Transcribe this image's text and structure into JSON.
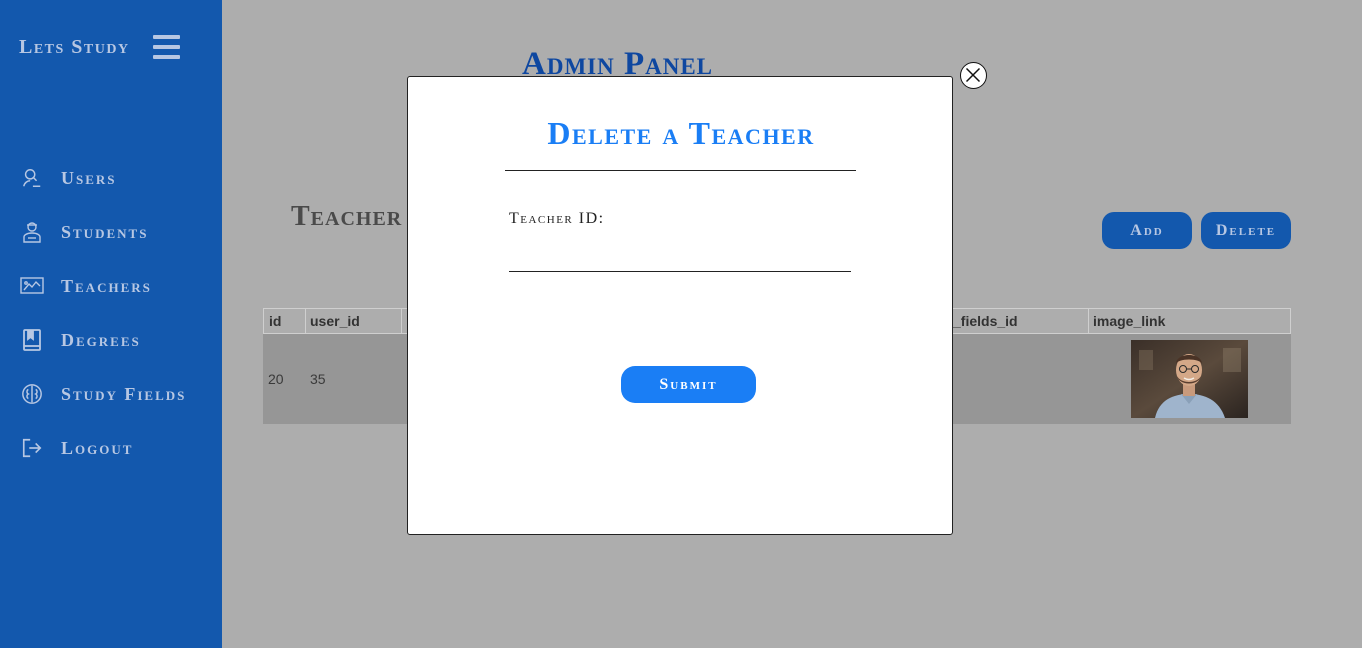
{
  "sidebar": {
    "brand": "Lets Study",
    "items": [
      {
        "label": "Users",
        "icon": "user-search-icon"
      },
      {
        "label": "Students",
        "icon": "student-icon"
      },
      {
        "label": "Teachers",
        "icon": "teacher-board-icon"
      },
      {
        "label": "Degrees",
        "icon": "book-icon"
      },
      {
        "label": "Study Fields",
        "icon": "brain-icon"
      },
      {
        "label": "Logout",
        "icon": "logout-icon"
      }
    ]
  },
  "main": {
    "title": "Admin Panel",
    "section_title": "Teacher",
    "add_label": "Add",
    "delete_label": "Delete"
  },
  "table": {
    "columns": [
      "id",
      "user_id",
      "_fields_id",
      "image_link"
    ],
    "rows": [
      {
        "id": "20",
        "user_id": "35",
        "image": "teacher-portrait"
      }
    ]
  },
  "modal": {
    "title": "Delete a Teacher",
    "field_label": "Teacher ID:",
    "field_value": "",
    "submit_label": "Submit",
    "close_icon": "close-icon"
  },
  "colors": {
    "sidebar_bg": "#1358ad",
    "overlay_bg": "#adadad",
    "accent": "#1a7ef5",
    "title_dark_blue": "#0e47a0"
  }
}
